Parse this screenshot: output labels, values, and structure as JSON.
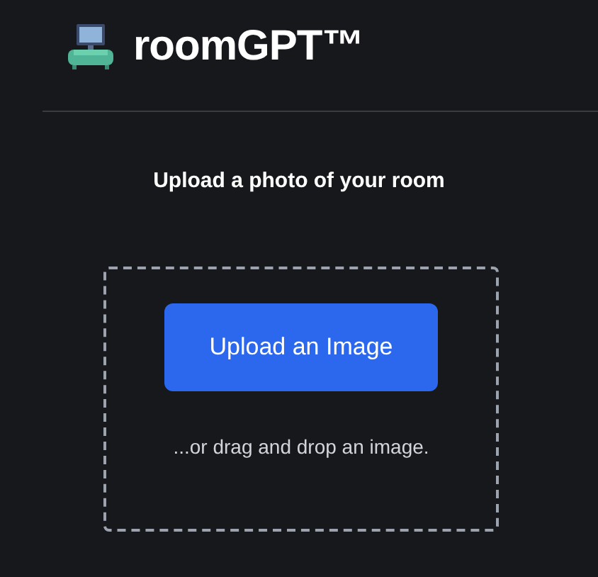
{
  "header": {
    "title": "roomGPT™"
  },
  "upload": {
    "heading": "Upload a photo of your room",
    "button": "Upload an Image",
    "hint": "...or drag and drop an image."
  }
}
